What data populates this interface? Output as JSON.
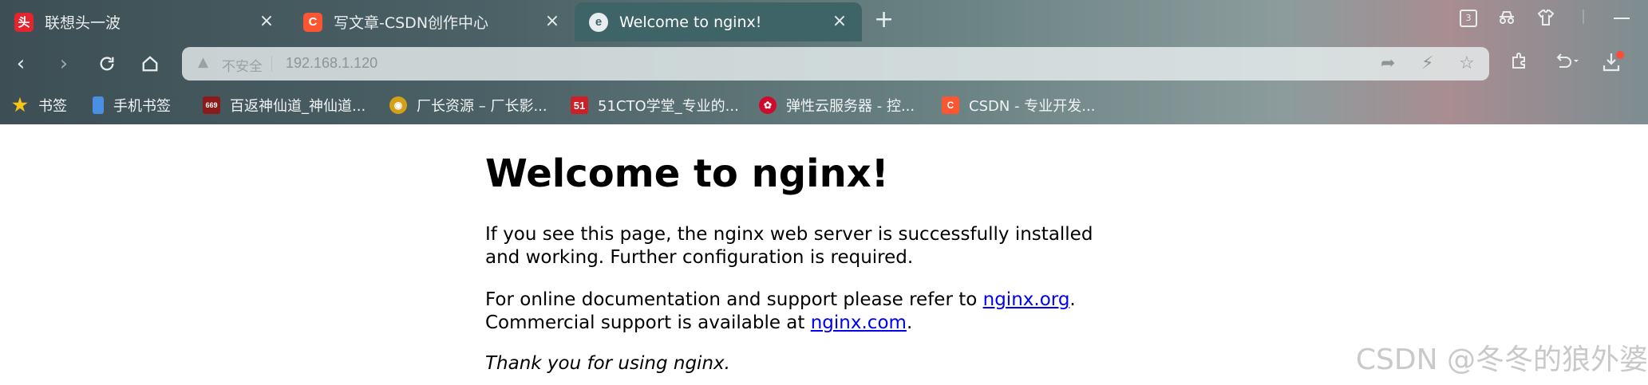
{
  "tabs": [
    {
      "title": "联想头一波",
      "icon": "lenovo-favicon",
      "active": false
    },
    {
      "title": "写文章-CSDN创作中心",
      "icon": "csdn-favicon",
      "active": false
    },
    {
      "title": "Welcome to nginx!",
      "icon": "browser-default-favicon",
      "active": true
    }
  ],
  "tabstrip": {
    "new_tab_label": "+",
    "tab_count_badge": "3"
  },
  "address_bar": {
    "security_label": "不安全",
    "url": "192.168.1.120"
  },
  "bookmarks": [
    {
      "label": "书签",
      "icon": "star-icon",
      "color": "#f5c518"
    },
    {
      "label": "手机书签",
      "icon": "mobile-bookmark-icon",
      "color": "#4a90e2"
    },
    {
      "label": "百返神仙道_神仙道...",
      "icon": "669-favicon",
      "color": "#8b1a1a"
    },
    {
      "label": "厂长资源 – 厂长影...",
      "icon": "cz-favicon",
      "color": "#d4a017"
    },
    {
      "label": "51CTO学堂_专业的...",
      "icon": "51cto-favicon",
      "color": "#cc1f26"
    },
    {
      "label": "弹性云服务器 - 控...",
      "icon": "huawei-favicon",
      "color": "#cf0a2c"
    },
    {
      "label": "CSDN - 专业开发...",
      "icon": "csdn-favicon",
      "color": "#fc5531"
    }
  ],
  "page": {
    "heading": "Welcome to nginx!",
    "para1": "If you see this page, the nginx web server is successfully installed and working. Further configuration is required.",
    "para2_prefix": "For online documentation and support please refer to ",
    "para2_link1": "nginx.org",
    "para2_mid": ".",
    "para2_line2_prefix": "Commercial support is available at ",
    "para2_link2": "nginx.com",
    "para2_suffix": ".",
    "para3": "Thank you for using nginx."
  },
  "watermark": "CSDN @冬冬的狼外婆",
  "colors": {
    "active_tab": "#3f6468",
    "link": "#0000ee",
    "csdn": "#fc5531"
  }
}
